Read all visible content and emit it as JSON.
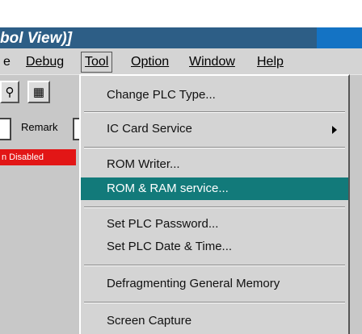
{
  "title": {
    "text": "bol View)]"
  },
  "menu": {
    "items": [
      {
        "label": "e",
        "active": false
      },
      {
        "label": "Debug",
        "active": false
      },
      {
        "label": "Tool",
        "active": true
      },
      {
        "label": "Option",
        "active": false
      },
      {
        "label": "Window",
        "active": false
      },
      {
        "label": "Help",
        "active": false
      }
    ]
  },
  "toolbar": {
    "icons": [
      "binoculars-icon",
      "grid-icon"
    ]
  },
  "remark": {
    "label": "Remark"
  },
  "status": {
    "badge": "n Disabled"
  },
  "dropdown": {
    "items": [
      {
        "label": "Change PLC Type...",
        "highlighted": false,
        "submenu": false
      },
      {
        "label": "IC Card Service",
        "highlighted": false,
        "submenu": true
      },
      {
        "label": "ROM Writer...",
        "highlighted": false,
        "submenu": false
      },
      {
        "label": "ROM & RAM service...",
        "highlighted": true,
        "submenu": false
      },
      {
        "label": "Set PLC Password...",
        "highlighted": false,
        "submenu": false
      },
      {
        "label": "Set PLC Date & Time...",
        "highlighted": false,
        "submenu": false
      },
      {
        "label": "Defragmenting General Memory",
        "highlighted": false,
        "submenu": false
      },
      {
        "label": "Screen Capture",
        "highlighted": false,
        "submenu": false
      }
    ]
  },
  "colors": {
    "title_bar": "#2d5e86",
    "highlight": "#127a7a",
    "status_red": "#e21616"
  }
}
